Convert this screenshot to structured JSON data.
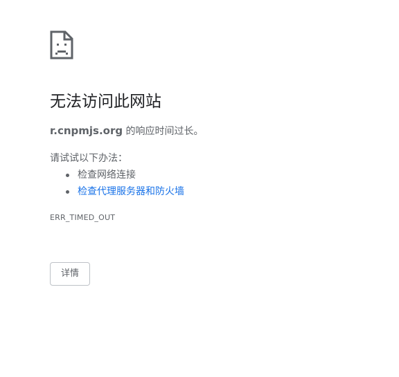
{
  "error_icon": "sad-page-icon",
  "title": "无法访问此网站",
  "summary": {
    "host": "r.cnpmjs.org",
    "message": " 的响应时间过长。"
  },
  "suggestions": {
    "heading": "请试试以下办法：",
    "items": [
      {
        "text": "检查网络连接",
        "is_link": false
      },
      {
        "text": "检查代理服务器和防火墙",
        "is_link": true
      }
    ]
  },
  "error_code": "ERR_TIMED_OUT",
  "details_button": "详情",
  "colors": {
    "title": "#202124",
    "body_text": "#5f6368",
    "link": "#1a73e8",
    "button_border": "#bdc1c6"
  }
}
